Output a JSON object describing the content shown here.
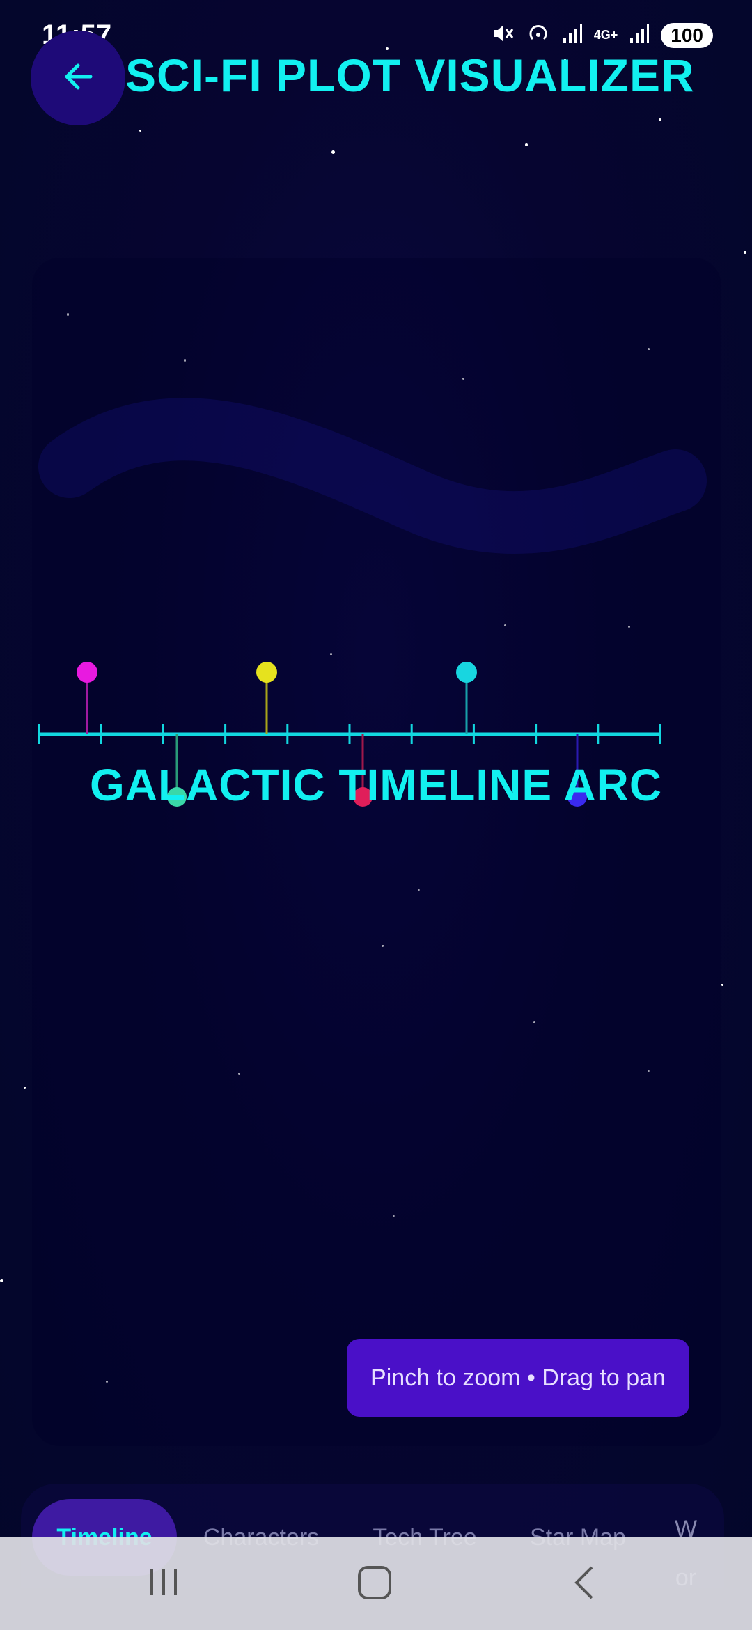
{
  "status_bar": {
    "time": "11:57",
    "battery": "100",
    "network": "4G+"
  },
  "header": {
    "back_icon": "arrow-left-icon",
    "title": "SCI-FI PLOT VISUALIZER"
  },
  "timeline": {
    "title": "GALACTIC TIMELINE ARC",
    "events_above": [
      "#e81ae0",
      "#e6e21e",
      "#18d6e0"
    ],
    "events_below": [
      "#3ad8a8",
      "#e01e5a",
      "#3a2af0"
    ]
  },
  "hint": "Pinch to zoom • Drag to pan",
  "tabs": [
    {
      "label": "Timeline",
      "active": true
    },
    {
      "label": "Characters",
      "active": false
    },
    {
      "label": "Tech Tree",
      "active": false
    },
    {
      "label": "Star Map",
      "active": false
    }
  ],
  "tab_more": [
    "W",
    "or"
  ],
  "colors": {
    "accent": "#12f0f0",
    "background": "#060530",
    "hint_bg": "#4a10c8",
    "active_tab_bg": "#3e1aa2"
  }
}
